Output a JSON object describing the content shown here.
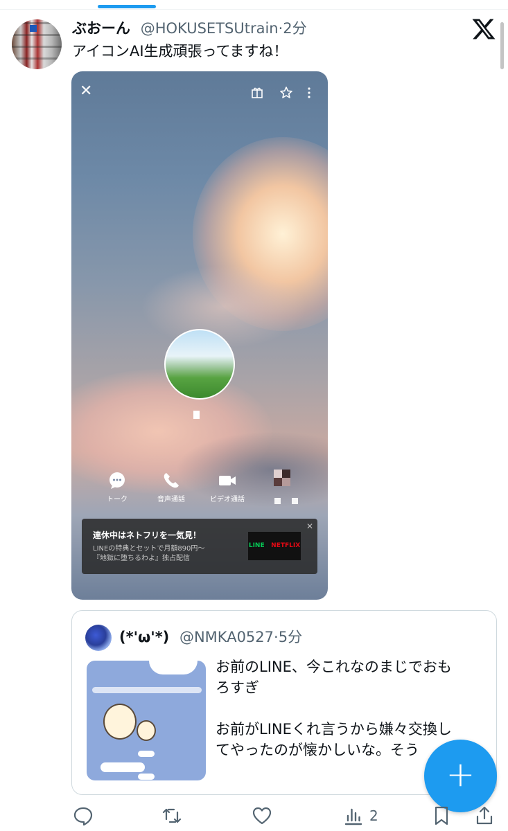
{
  "tweet": {
    "author_name": "ぶおーん",
    "author_handle": "@HOKUSETSUtrain",
    "time": "2分",
    "text": "アイコンAI生成頑張ってますね！"
  },
  "media": {
    "actions": [
      {
        "label": "トーク",
        "icon": "chat-bubble-icon"
      },
      {
        "label": "音声通話",
        "icon": "phone-icon"
      },
      {
        "label": "ビデオ通話",
        "icon": "video-camera-icon"
      }
    ],
    "ad": {
      "title": "連休中はネトフリを一気見！",
      "line1": "LINEの特典とセットで月額890円〜",
      "line2": "『地獄に堕ちるわよ』独占配信",
      "logo_left": "LINE",
      "logo_right": "NETFLIX"
    }
  },
  "quote": {
    "author_name": "(*'ω'*)",
    "author_handle": "@NMKA0527",
    "time": "5分",
    "text_line1": "お前のLINE、今これなのまじでおも",
    "text_line2": "ろすぎ",
    "text_line3": "お前がLINEくれ言うから嫌々交換し",
    "text_line4": "てやったのが懐かしいな。そう"
  },
  "actions": {
    "views_count": "2"
  },
  "colors": {
    "accent": "#1d9bf0",
    "secondary_text": "#536471",
    "border": "#cfd9de"
  }
}
